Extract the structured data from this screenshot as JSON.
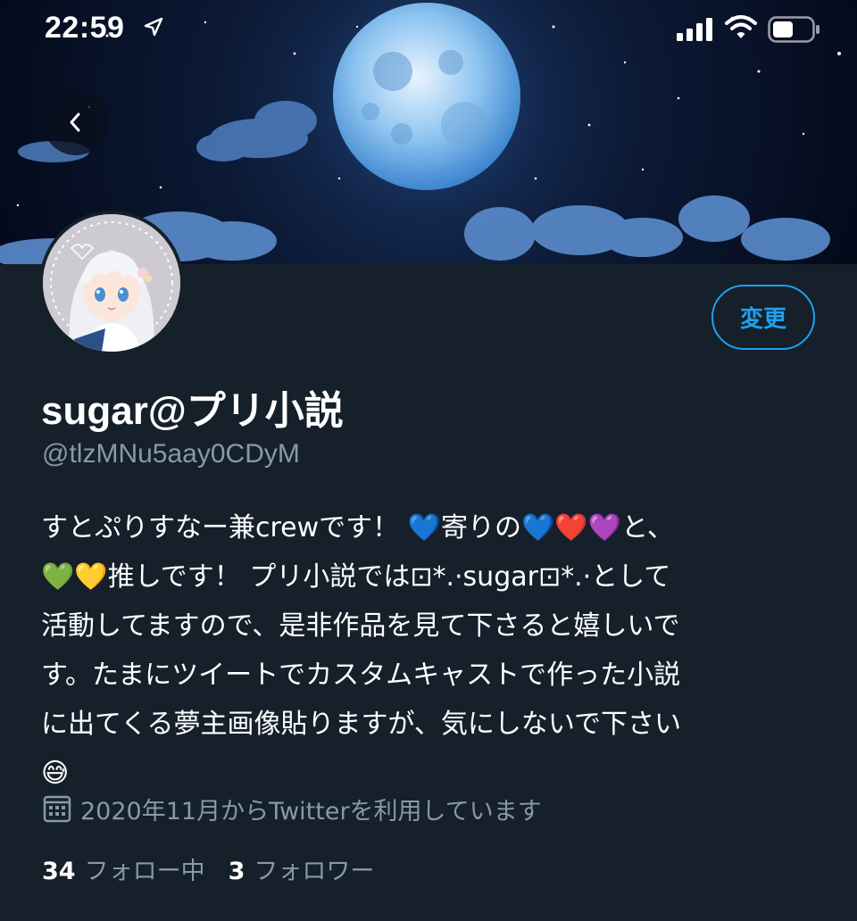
{
  "status_bar": {
    "time": "22:59",
    "location_icon": "location-arrow-icon",
    "signal_icon": "cellular-signal-icon",
    "wifi_icon": "wifi-icon",
    "battery_icon": "battery-icon"
  },
  "header": {
    "back_icon": "chevron-left-icon",
    "banner": "night-sky-full-moon-banner"
  },
  "profile": {
    "edit_label": "変更",
    "display_name": "sugar@プリ小説",
    "handle": "@tlzMNu5aay0CDyM",
    "bio_lines": [
      "すとぷりすなー兼crewです！ 💙寄りの💙❤️💜と、",
      "💚💛推しです！ プリ小説では⊡*.·sugar⊡*.·として",
      "活動してますので、是非作品を見て下さると嬉しいで",
      "す。たまにツイートでカスタムキャストで作った小説",
      "に出てくる夢主画像貼りますが、気にしないで下さい",
      "😅"
    ],
    "joined_icon": "calendar-icon",
    "joined_text": "2020年11月からTwitterを利用しています",
    "following_count": "34",
    "following_label": "フォロー中",
    "followers_count": "3",
    "followers_label": "フォロワー"
  },
  "colors": {
    "background": "#15202b",
    "accent": "#1da1f2",
    "secondary_text": "#8899a6"
  }
}
